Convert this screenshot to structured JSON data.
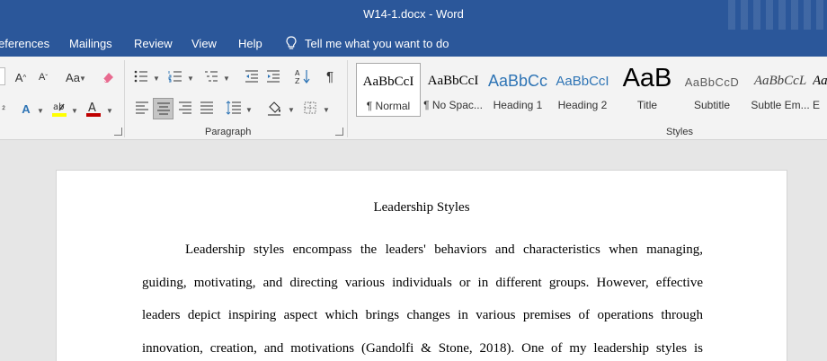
{
  "window": {
    "title": "W14-1.docx  -  Word"
  },
  "tabs": [
    "eferences",
    "Mailings",
    "Review",
    "View",
    "Help"
  ],
  "tell_me": "Tell me what you want to do",
  "ribbon": {
    "paragraph_label": "Paragraph",
    "styles_label": "Styles",
    "styles": [
      {
        "sample": "AaBbCcI",
        "name": "¶ Normal"
      },
      {
        "sample": "AaBbCcI",
        "name": "¶ No Spac..."
      },
      {
        "sample": "AaBbCc",
        "name": "Heading 1"
      },
      {
        "sample": "AaBbCcI",
        "name": "Heading 2"
      },
      {
        "sample": "AaB",
        "name": "Title"
      },
      {
        "sample": "AaBbCcD",
        "name": "Subtitle"
      },
      {
        "sample": "AaBbCcL",
        "name": "Subtle Em..."
      },
      {
        "sample": "Aa",
        "name": "E"
      }
    ]
  },
  "document": {
    "title": "Leadership Styles",
    "lines": [
      "Leadership styles encompass the leaders' behaviors and characteristics when managing,",
      "guiding, motivating, and directing various individuals or in different groups. However, effective",
      "leaders depict inspiring aspect which brings changes in various premises of operations through",
      "innovation, creation, and motivations (Gandolfi & Stone, 2018). One of my leadership styles is"
    ]
  },
  "colors": {
    "title_bar": "#2b579a",
    "heading_blue": "#2e74b5",
    "highlight": "#ffff00",
    "font_color": "#c00000"
  }
}
